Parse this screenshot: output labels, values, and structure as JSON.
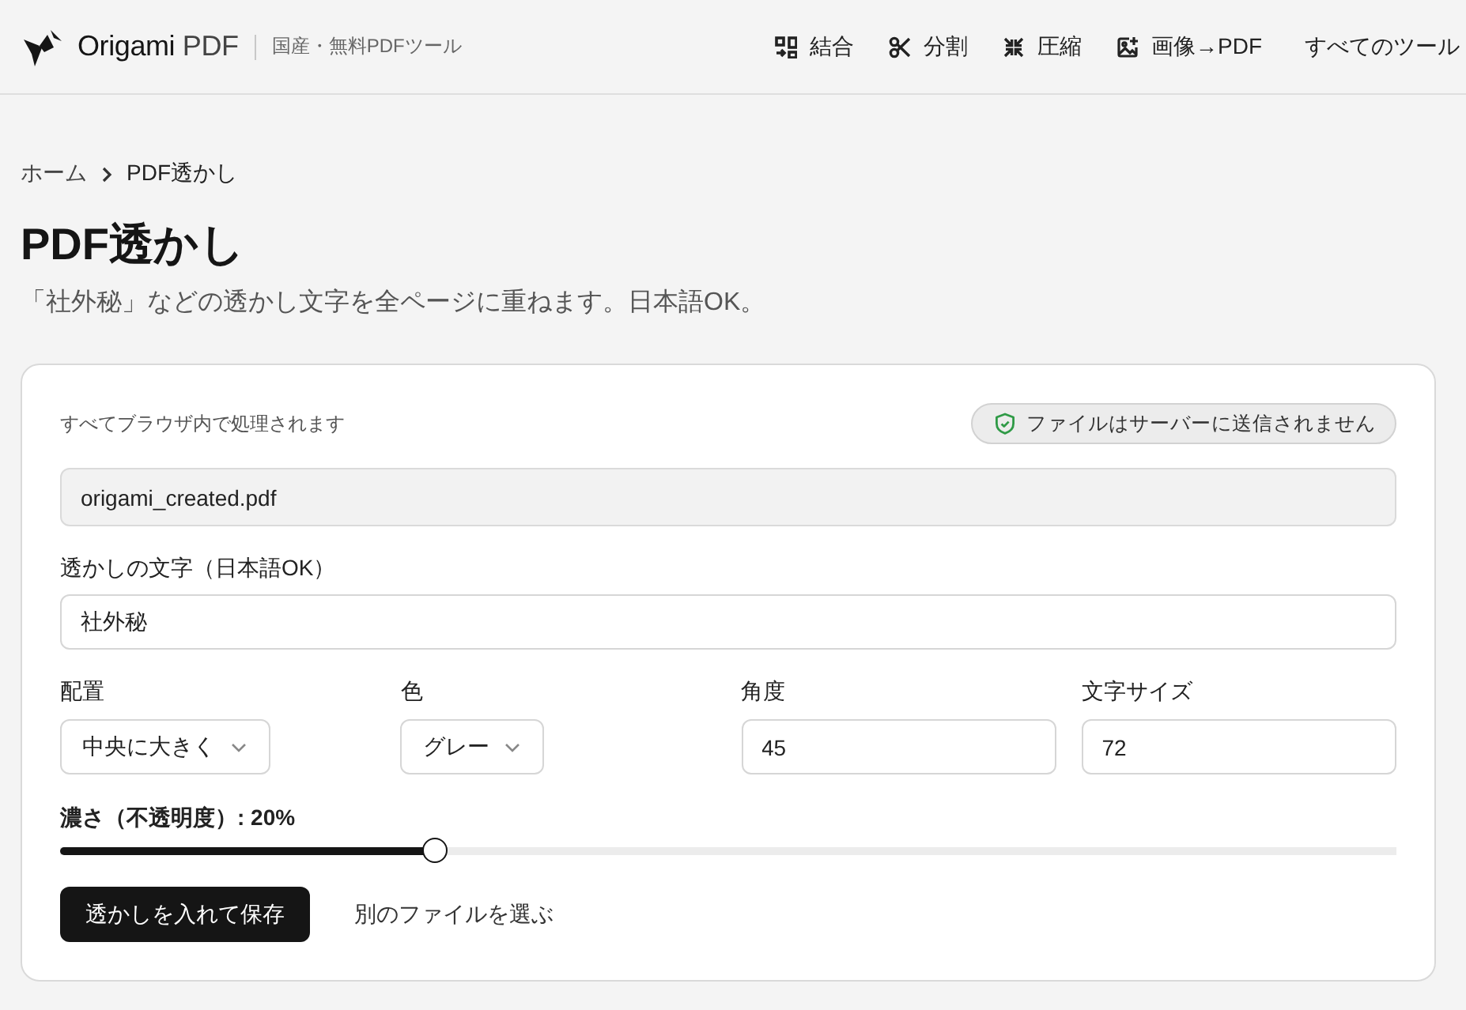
{
  "header": {
    "brand": {
      "word": "Origami",
      "suffix": "PDF"
    },
    "tagline": "国産・無料PDFツール",
    "nav": [
      {
        "kind": "merge",
        "label": "結合"
      },
      {
        "kind": "split",
        "label": "分割"
      },
      {
        "kind": "compress",
        "label": "圧縮"
      },
      {
        "kind": "image",
        "label": "画像→PDF"
      },
      {
        "kind": "text",
        "label": "すべてのツール"
      }
    ]
  },
  "breadcrumb": [
    {
      "label": "ホーム",
      "kind": "link"
    },
    {
      "label": "PDF透かし",
      "kind": "current"
    }
  ],
  "title": "PDF透かし",
  "subtitle": "「社外秘」などの透かし文字を全ページに重ねます。日本語OK。",
  "card": {
    "note": "すべてブラウザ内で処理されます",
    "badge": "ファイルはサーバーに送信されません",
    "file": {
      "value": "origami_created.pdf"
    },
    "text_field": {
      "label": "透かしの文字（日本語OK）",
      "value": "社外秘"
    },
    "options": [
      {
        "kind": "select",
        "label": "配置",
        "value": "中央に大きく"
      },
      {
        "kind": "select",
        "label": "色",
        "value": "グレー"
      },
      {
        "kind": "input",
        "label": "角度",
        "value": "45"
      },
      {
        "kind": "input",
        "label": "文字サイズ",
        "value": "72"
      }
    ],
    "opacity": {
      "label": "濃さ（不透明度）: 20%",
      "level": 0.28
    },
    "buttons": [
      {
        "kind": "primary",
        "label": "透かしを入れて保存"
      },
      {
        "kind": "link",
        "label": "別のファイルを選ぶ"
      }
    ]
  }
}
